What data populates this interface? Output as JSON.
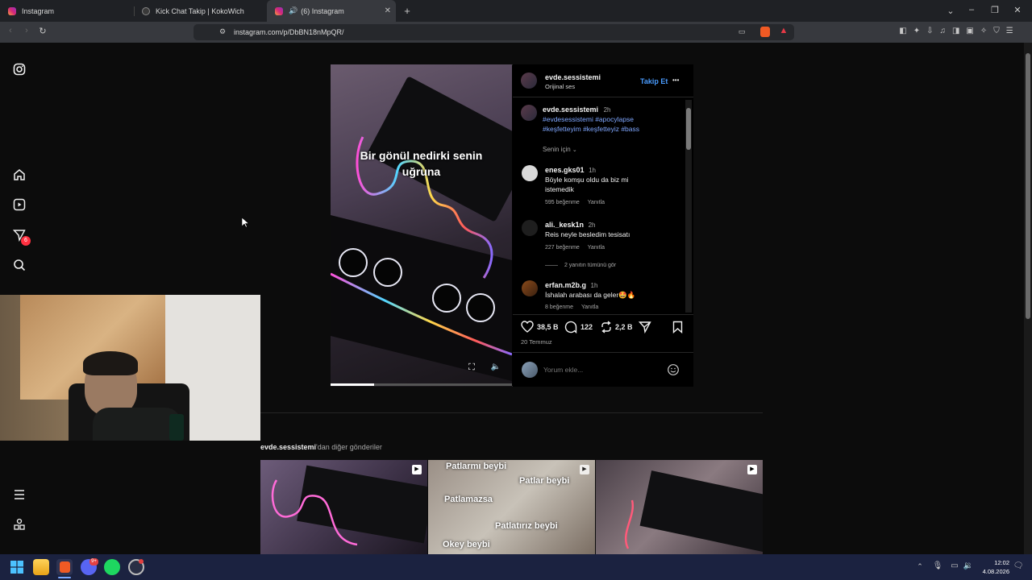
{
  "browser": {
    "tabs": [
      {
        "title": "Instagram"
      },
      {
        "title": "Kick Chat Takip | KokoWich"
      },
      {
        "title": "(6) Instagram"
      }
    ],
    "url": "instagram.com/p/DbBN18nMpQR/"
  },
  "sidebar": {
    "notification_badge": "6"
  },
  "video": {
    "caption_line1": "Bir gönül nedirki senin",
    "caption_line2": "uğruna"
  },
  "post": {
    "author": "evde.sessistemi",
    "audio": "Orijinal ses",
    "follow_label": "Takip Et",
    "more": "•••",
    "caption_user": "evde.sessistemi",
    "caption_time": "2h",
    "hashtags_line1": "#evdesessistemi #apocylapse",
    "hashtags_line2": "#keşfetteyim #keşfetteyiz #bass",
    "sort_label": "Senin için",
    "comments": [
      {
        "user": "enes.gks01",
        "time": "1h",
        "text1": "Böyle komşu oldu da biz mi",
        "text2": "istemedik",
        "likes": "595 beğenme",
        "reply": "Yanıtla"
      },
      {
        "user": "ali._kesk1n",
        "time": "2h",
        "text1": "Reis neyle besledim tesisatı",
        "text2": "",
        "likes": "227 beğenme",
        "reply": "Yanıtla"
      },
      {
        "user": "erfan.m2b.g",
        "time": "1h",
        "text1": "İshalah arabası da geler🤩🔥",
        "text2": "",
        "likes": "8 beğenme",
        "reply": "Yanıtla"
      }
    ],
    "view_replies": "2 yanıtın tümünü gör",
    "likes_count": "38,5 B",
    "comments_count": "122",
    "reposts_count": "2,2 B",
    "date": "20 Temmuz",
    "comment_placeholder": "Yorum ekle..."
  },
  "more_posts": {
    "user": "evde.sessistemi",
    "suffix": "'dan diğer gönderiler",
    "thumb2_lines": [
      "Patlarmı beybi",
      "Patlar beybi",
      "Patlamazsa",
      "Patlatırız beybi",
      "Okey beybi"
    ]
  },
  "taskbar": {
    "time": "12:02",
    "date": "4.08.2026",
    "discord_badge": "9+"
  }
}
